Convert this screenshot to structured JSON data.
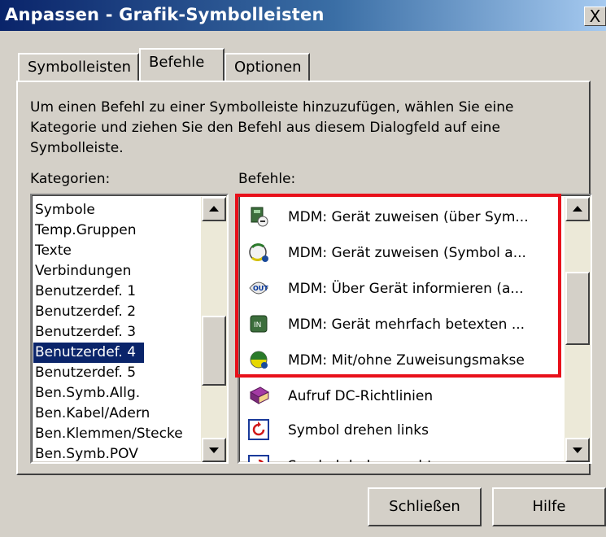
{
  "window": {
    "title": "Anpassen - Grafik-Symbolleisten",
    "close_label": "X"
  },
  "tabs": [
    {
      "label": "Symbolleisten",
      "active": false
    },
    {
      "label": "Befehle",
      "active": true
    },
    {
      "label": "Optionen",
      "active": false
    }
  ],
  "description": "Um einen Befehl zu einer Symbolleiste hinzuzufügen, wählen Sie eine Kategorie und ziehen Sie den Befehl aus diesem Dialogfeld auf eine Symbolleiste.",
  "categories": {
    "label": "Kategorien:",
    "items": [
      "Symbole",
      "Temp.Gruppen",
      "Texte",
      "Verbindungen",
      "Benutzerdef. 1",
      "Benutzerdef. 2",
      "Benutzerdef. 3",
      "Benutzerdef. 4",
      "Benutzerdef. 5",
      "Ben.Symb.Allg.",
      "Ben.Kabel/Adern",
      "Ben.Klemmen/Stecke",
      "Ben.Symb.POV"
    ],
    "selected": "Benutzerdef. 4"
  },
  "commands": {
    "label": "Befehle:",
    "items": [
      {
        "label": "MDM: Gerät zuweisen (über Sym...",
        "icon": "device-assign-icon"
      },
      {
        "label": "MDM: Gerät zuweisen (Symbol a...",
        "icon": "device-assign-symbol-icon"
      },
      {
        "label": "MDM: Über Gerät informieren (a...",
        "icon": "device-info-icon"
      },
      {
        "label": "MDM: Gerät mehrfach betexten ...",
        "icon": "device-multi-text-icon"
      },
      {
        "label": "MDM: Mit/ohne Zuweisungsmakse",
        "icon": "assignment-mask-icon"
      },
      {
        "label": "Aufruf DC-Richtlinien",
        "icon": "book-icon"
      },
      {
        "label": "Symbol drehen links",
        "icon": "rotate-left-icon"
      },
      {
        "label": "Symbol drehen rechts",
        "icon": "rotate-right-icon"
      }
    ]
  },
  "buttons": {
    "close": "Schließen",
    "help": "Hilfe"
  },
  "colors": {
    "title_start": "#0a246a",
    "selection": "#0a246a",
    "highlight": "#e8101a"
  }
}
